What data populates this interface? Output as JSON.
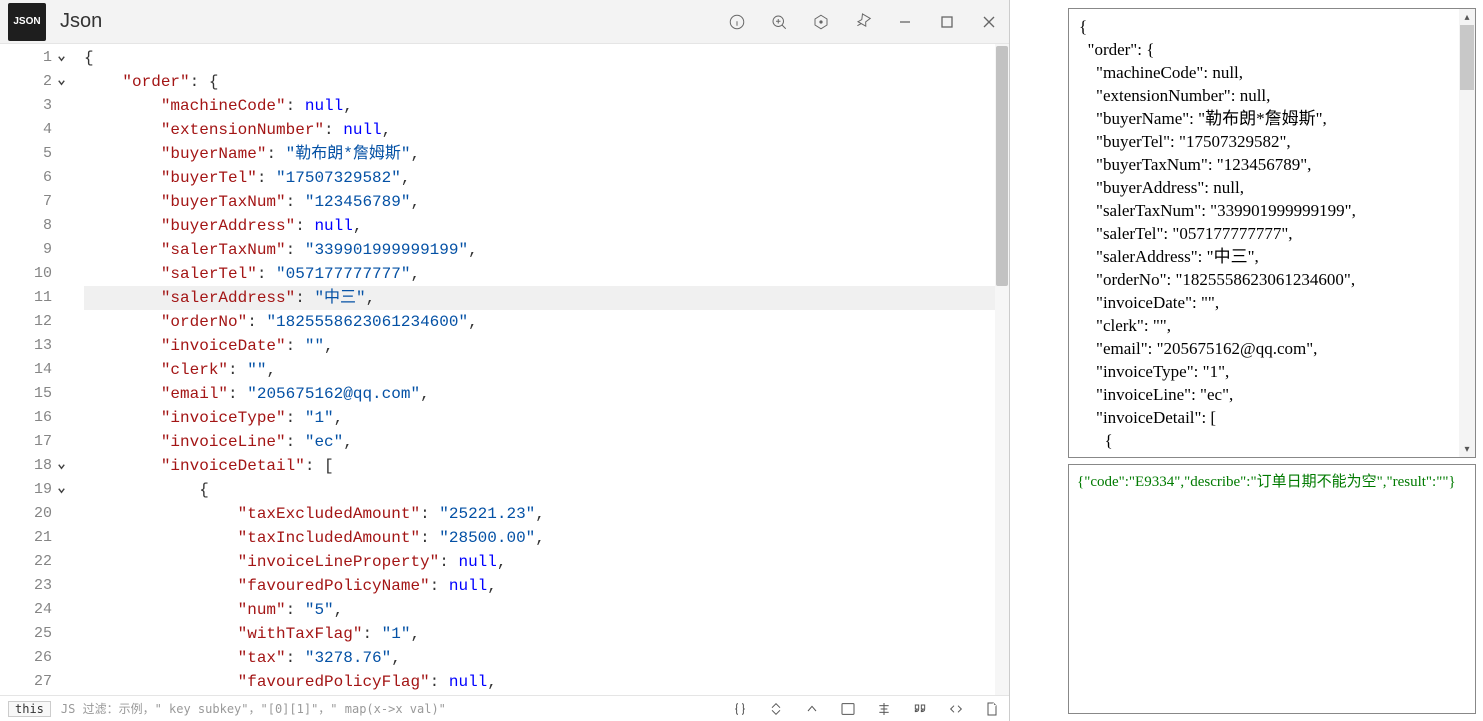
{
  "window": {
    "appIconText": "JSON",
    "title": "Json"
  },
  "editor": {
    "lines": [
      {
        "n": 1,
        "fold": true,
        "indent": 0,
        "tokens": [
          {
            "t": "{",
            "c": "punct"
          }
        ]
      },
      {
        "n": 2,
        "fold": true,
        "indent": 1,
        "tokens": [
          {
            "t": "\"order\"",
            "c": "key"
          },
          {
            "t": ": ",
            "c": "punct"
          },
          {
            "t": "{",
            "c": "punct"
          }
        ]
      },
      {
        "n": 3,
        "indent": 2,
        "tokens": [
          {
            "t": "\"machineCode\"",
            "c": "key"
          },
          {
            "t": ": ",
            "c": "punct"
          },
          {
            "t": "null",
            "c": "null"
          },
          {
            "t": ",",
            "c": "punct"
          }
        ]
      },
      {
        "n": 4,
        "indent": 2,
        "tokens": [
          {
            "t": "\"extensionNumber\"",
            "c": "key"
          },
          {
            "t": ": ",
            "c": "punct"
          },
          {
            "t": "null",
            "c": "null"
          },
          {
            "t": ",",
            "c": "punct"
          }
        ]
      },
      {
        "n": 5,
        "indent": 2,
        "tokens": [
          {
            "t": "\"buyerName\"",
            "c": "key"
          },
          {
            "t": ": ",
            "c": "punct"
          },
          {
            "t": "\"勒布朗*詹姆斯\"",
            "c": "str"
          },
          {
            "t": ",",
            "c": "punct"
          }
        ]
      },
      {
        "n": 6,
        "indent": 2,
        "tokens": [
          {
            "t": "\"buyerTel\"",
            "c": "key"
          },
          {
            "t": ": ",
            "c": "punct"
          },
          {
            "t": "\"17507329582\"",
            "c": "str"
          },
          {
            "t": ",",
            "c": "punct"
          }
        ]
      },
      {
        "n": 7,
        "indent": 2,
        "tokens": [
          {
            "t": "\"buyerTaxNum\"",
            "c": "key"
          },
          {
            "t": ": ",
            "c": "punct"
          },
          {
            "t": "\"123456789\"",
            "c": "str"
          },
          {
            "t": ",",
            "c": "punct"
          }
        ]
      },
      {
        "n": 8,
        "indent": 2,
        "tokens": [
          {
            "t": "\"buyerAddress\"",
            "c": "key"
          },
          {
            "t": ": ",
            "c": "punct"
          },
          {
            "t": "null",
            "c": "null"
          },
          {
            "t": ",",
            "c": "punct"
          }
        ]
      },
      {
        "n": 9,
        "indent": 2,
        "tokens": [
          {
            "t": "\"salerTaxNum\"",
            "c": "key"
          },
          {
            "t": ": ",
            "c": "punct"
          },
          {
            "t": "\"339901999999199\"",
            "c": "str"
          },
          {
            "t": ",",
            "c": "punct"
          }
        ]
      },
      {
        "n": 10,
        "indent": 2,
        "tokens": [
          {
            "t": "\"salerTel\"",
            "c": "key"
          },
          {
            "t": ": ",
            "c": "punct"
          },
          {
            "t": "\"057177777777\"",
            "c": "str"
          },
          {
            "t": ",",
            "c": "punct"
          }
        ]
      },
      {
        "n": 11,
        "hl": true,
        "indent": 2,
        "tokens": [
          {
            "t": "\"salerAddress\"",
            "c": "key"
          },
          {
            "t": ": ",
            "c": "punct"
          },
          {
            "t": "\"中三\"",
            "c": "str"
          },
          {
            "t": ",",
            "c": "punct"
          }
        ]
      },
      {
        "n": 12,
        "indent": 2,
        "tokens": [
          {
            "t": "\"orderNo\"",
            "c": "key"
          },
          {
            "t": ": ",
            "c": "punct"
          },
          {
            "t": "\"1825558623061234600\"",
            "c": "str"
          },
          {
            "t": ",",
            "c": "punct"
          }
        ]
      },
      {
        "n": 13,
        "indent": 2,
        "tokens": [
          {
            "t": "\"invoiceDate\"",
            "c": "key"
          },
          {
            "t": ": ",
            "c": "punct"
          },
          {
            "t": "\"\"",
            "c": "str"
          },
          {
            "t": ",",
            "c": "punct"
          }
        ]
      },
      {
        "n": 14,
        "indent": 2,
        "tokens": [
          {
            "t": "\"clerk\"",
            "c": "key"
          },
          {
            "t": ": ",
            "c": "punct"
          },
          {
            "t": "\"\"",
            "c": "str"
          },
          {
            "t": ",",
            "c": "punct"
          }
        ]
      },
      {
        "n": 15,
        "indent": 2,
        "tokens": [
          {
            "t": "\"email\"",
            "c": "key"
          },
          {
            "t": ": ",
            "c": "punct"
          },
          {
            "t": "\"205675162@qq.com\"",
            "c": "str"
          },
          {
            "t": ",",
            "c": "punct"
          }
        ]
      },
      {
        "n": 16,
        "indent": 2,
        "tokens": [
          {
            "t": "\"invoiceType\"",
            "c": "key"
          },
          {
            "t": ": ",
            "c": "punct"
          },
          {
            "t": "\"1\"",
            "c": "str"
          },
          {
            "t": ",",
            "c": "punct"
          }
        ]
      },
      {
        "n": 17,
        "indent": 2,
        "tokens": [
          {
            "t": "\"invoiceLine\"",
            "c": "key"
          },
          {
            "t": ": ",
            "c": "punct"
          },
          {
            "t": "\"ec\"",
            "c": "str"
          },
          {
            "t": ",",
            "c": "punct"
          }
        ]
      },
      {
        "n": 18,
        "fold": true,
        "indent": 2,
        "tokens": [
          {
            "t": "\"invoiceDetail\"",
            "c": "key"
          },
          {
            "t": ": ",
            "c": "punct"
          },
          {
            "t": "[",
            "c": "punct"
          }
        ]
      },
      {
        "n": 19,
        "fold": true,
        "indent": 3,
        "tokens": [
          {
            "t": "{",
            "c": "punct"
          }
        ]
      },
      {
        "n": 20,
        "indent": 4,
        "tokens": [
          {
            "t": "\"taxExcludedAmount\"",
            "c": "key"
          },
          {
            "t": ": ",
            "c": "punct"
          },
          {
            "t": "\"25221.23\"",
            "c": "str"
          },
          {
            "t": ",",
            "c": "punct"
          }
        ]
      },
      {
        "n": 21,
        "indent": 4,
        "tokens": [
          {
            "t": "\"taxIncludedAmount\"",
            "c": "key"
          },
          {
            "t": ": ",
            "c": "punct"
          },
          {
            "t": "\"28500.00\"",
            "c": "str"
          },
          {
            "t": ",",
            "c": "punct"
          }
        ]
      },
      {
        "n": 22,
        "indent": 4,
        "tokens": [
          {
            "t": "\"invoiceLineProperty\"",
            "c": "key"
          },
          {
            "t": ": ",
            "c": "punct"
          },
          {
            "t": "null",
            "c": "null"
          },
          {
            "t": ",",
            "c": "punct"
          }
        ]
      },
      {
        "n": 23,
        "indent": 4,
        "tokens": [
          {
            "t": "\"favouredPolicyName\"",
            "c": "key"
          },
          {
            "t": ": ",
            "c": "punct"
          },
          {
            "t": "null",
            "c": "null"
          },
          {
            "t": ",",
            "c": "punct"
          }
        ]
      },
      {
        "n": 24,
        "indent": 4,
        "tokens": [
          {
            "t": "\"num\"",
            "c": "key"
          },
          {
            "t": ": ",
            "c": "punct"
          },
          {
            "t": "\"5\"",
            "c": "str"
          },
          {
            "t": ",",
            "c": "punct"
          }
        ]
      },
      {
        "n": 25,
        "indent": 4,
        "tokens": [
          {
            "t": "\"withTaxFlag\"",
            "c": "key"
          },
          {
            "t": ": ",
            "c": "punct"
          },
          {
            "t": "\"1\"",
            "c": "str"
          },
          {
            "t": ",",
            "c": "punct"
          }
        ]
      },
      {
        "n": 26,
        "indent": 4,
        "tokens": [
          {
            "t": "\"tax\"",
            "c": "key"
          },
          {
            "t": ": ",
            "c": "punct"
          },
          {
            "t": "\"3278.76\"",
            "c": "str"
          },
          {
            "t": ",",
            "c": "punct"
          }
        ]
      },
      {
        "n": 27,
        "indent": 4,
        "tokens": [
          {
            "t": "\"favouredPolicyFlag\"",
            "c": "key"
          },
          {
            "t": ": ",
            "c": "punct"
          },
          {
            "t": "null",
            "c": "null"
          },
          {
            "t": ",",
            "c": "punct"
          }
        ]
      }
    ]
  },
  "statusBar": {
    "this": "this",
    "hint": "JS 过滤：示例，\" key subkey\"，\"[0][1]\"，\" map(x->x val)\""
  },
  "preview": {
    "lines": [
      "{",
      "  \"order\": {",
      "    \"machineCode\": null,",
      "    \"extensionNumber\": null,",
      "    \"buyerName\": \"勒布朗*詹姆斯\",",
      "    \"buyerTel\": \"17507329582\",",
      "    \"buyerTaxNum\": \"123456789\",",
      "    \"buyerAddress\": null,",
      "    \"salerTaxNum\": \"339901999999199\",",
      "    \"salerTel\": \"057177777777\",",
      "    \"salerAddress\": \"中三\",",
      "    \"orderNo\": \"1825558623061234600\",",
      "    \"invoiceDate\": \"\",",
      "    \"clerk\": \"\",",
      "    \"email\": \"205675162@qq.com\",",
      "    \"invoiceType\": \"1\",",
      "    \"invoiceLine\": \"ec\",",
      "    \"invoiceDetail\": [",
      "      {"
    ]
  },
  "result": {
    "text": "{\"code\":\"E9334\",\"describe\":\"订单日期不能为空\",\"result\":\"\"}"
  }
}
